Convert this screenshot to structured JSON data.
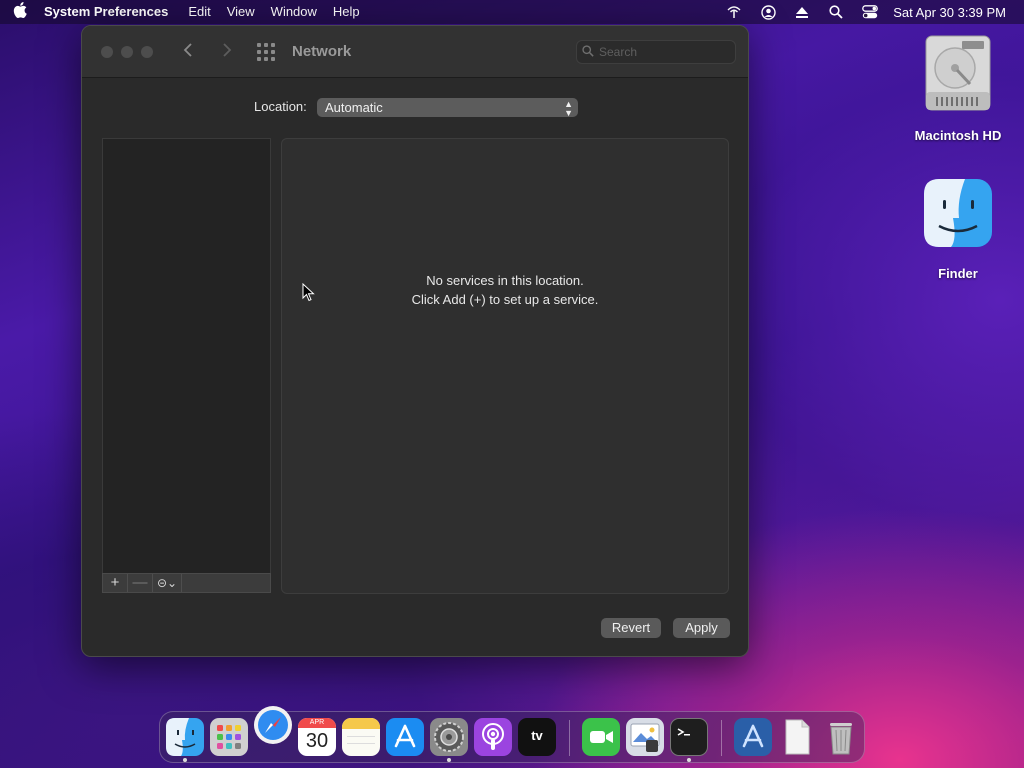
{
  "menubar": {
    "app_name": "System Preferences",
    "menus": [
      "Edit",
      "View",
      "Window",
      "Help"
    ],
    "clock": "Sat Apr 30  3:39 PM",
    "status_icons": [
      "wifi-icon",
      "user-icon",
      "eject-icon",
      "search-icon",
      "control-center-icon"
    ]
  },
  "window": {
    "title": "Network",
    "search_placeholder": "Search",
    "location_label": "Location:",
    "location_value": "Automatic",
    "empty_line1": "No services in this location.",
    "empty_line2": "Click Add (+) to set up a service.",
    "toolbar": {
      "add": "+",
      "remove": "—",
      "action": "⊝⌄"
    },
    "revert_label": "Revert",
    "apply_label": "Apply"
  },
  "desktop": {
    "icons": [
      {
        "label": "Macintosh HD",
        "icon": "hard-drive-icon"
      },
      {
        "label": "Finder",
        "icon": "finder-icon"
      }
    ]
  },
  "dock": {
    "calendar_month": "APR",
    "calendar_day": "30",
    "tv_label": "tv",
    "apps": [
      "Finder",
      "Launchpad",
      "Safari",
      "Calendar",
      "Notes",
      "App Store",
      "System Preferences",
      "Podcasts",
      "TV",
      "FaceTime",
      "Preview",
      "Terminal",
      "Xcode",
      "Document",
      "Trash"
    ]
  }
}
